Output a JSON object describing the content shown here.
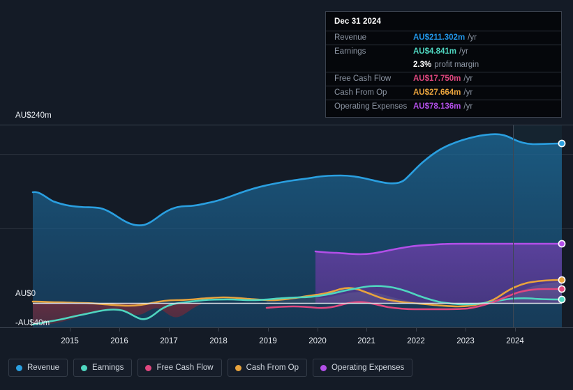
{
  "tooltip": {
    "date": "Dec 31 2024",
    "rows": [
      {
        "key": "Revenue",
        "value": "AU$211.302m",
        "unit": "/yr",
        "color": "#2196e8"
      },
      {
        "key": "Earnings",
        "value": "AU$4.841m",
        "unit": "/yr",
        "color": "#4fd6c0"
      },
      {
        "key": "",
        "value": "2.3%",
        "unit": "profit margin",
        "color": "#ffffff",
        "margin": true
      },
      {
        "key": "Free Cash Flow",
        "value": "AU$17.750m",
        "unit": "/yr",
        "color": "#e0477f"
      },
      {
        "key": "Cash From Op",
        "value": "AU$27.664m",
        "unit": "/yr",
        "color": "#e8a33d"
      },
      {
        "key": "Operating Expenses",
        "value": "AU$78.136m",
        "unit": "/yr",
        "color": "#b24fe8"
      }
    ]
  },
  "legend": [
    {
      "label": "Revenue",
      "color": "#2a9fe0"
    },
    {
      "label": "Earnings",
      "color": "#4fd6c0"
    },
    {
      "label": "Free Cash Flow",
      "color": "#e0477f"
    },
    {
      "label": "Cash From Op",
      "color": "#e8a33d"
    },
    {
      "label": "Operating Expenses",
      "color": "#b24fe8"
    }
  ],
  "axis": {
    "y_top_label": "AU$240m",
    "y_zero_label": "AU$0",
    "y_bottom_label": "-AU$40m",
    "x_labels": [
      "2015",
      "2016",
      "2017",
      "2018",
      "2019",
      "2020",
      "2021",
      "2022",
      "2023",
      "2024"
    ]
  },
  "chart_data": {
    "type": "area",
    "title": "",
    "xlabel": "",
    "ylabel": "AU$ millions",
    "ylim": [
      -40,
      240
    ],
    "grid": true,
    "legend_position": "bottom",
    "currency": "AU$",
    "units": "millions per year",
    "x": [
      2014.4,
      2014.8,
      2015.2,
      2015.6,
      2016.0,
      2016.4,
      2016.8,
      2017.2,
      2017.6,
      2018.0,
      2018.4,
      2018.8,
      2019.2,
      2019.6,
      2020.0,
      2020.4,
      2020.8,
      2021.2,
      2021.6,
      2022.0,
      2022.4,
      2022.8,
      2023.2,
      2023.6,
      2023.9,
      2024.3,
      2024.7,
      2024.95
    ],
    "series": [
      {
        "name": "Revenue",
        "color": "#2a9fe0",
        "filled": true,
        "values": [
          151,
          146,
          143,
          129,
          122,
          122,
          128,
          124,
          125,
          131,
          140,
          147,
          152,
          155,
          160,
          164,
          163,
          161,
          157,
          153,
          154,
          176,
          195,
          208,
          217,
          211,
          209,
          211.302
        ]
      },
      {
        "name": "Earnings",
        "color": "#4fd6c0",
        "filled": false,
        "values": [
          -36,
          -27,
          -24,
          -23,
          -19,
          -30,
          -13,
          -7,
          -4,
          -3,
          -2,
          -4,
          -6,
          -5,
          -3,
          0,
          3,
          6,
          9,
          10,
          7,
          3,
          1,
          2,
          3,
          4,
          5,
          4.841
        ]
      },
      {
        "name": "Free Cash Flow",
        "color": "#e0477f",
        "filled": false,
        "start_x": 2018.8,
        "values": [
          null,
          null,
          null,
          null,
          null,
          null,
          null,
          null,
          null,
          null,
          null,
          -7,
          -6,
          -5,
          -6,
          -4,
          -1,
          -4,
          -6,
          -6,
          -6,
          -6,
          -4,
          -1,
          7,
          15,
          17,
          17.75
        ]
      },
      {
        "name": "Cash From Op",
        "color": "#e8a33d",
        "filled": false,
        "values": [
          -3,
          -3,
          -3,
          -3,
          -3,
          -4,
          -4,
          -2,
          -1,
          0,
          0,
          -1,
          -2,
          -2,
          -1,
          1,
          4,
          1,
          -1,
          -2,
          -3,
          -5,
          -6,
          -3,
          6,
          22,
          27,
          27.664
        ]
      },
      {
        "name": "Operating Expenses",
        "color": "#b24fe8",
        "filled": true,
        "start_x": 2020.0,
        "values": [
          null,
          null,
          null,
          null,
          null,
          null,
          null,
          null,
          null,
          null,
          null,
          null,
          null,
          null,
          70,
          68,
          67,
          67,
          69,
          73,
          75,
          76,
          77,
          77,
          78,
          78,
          78,
          78.136
        ]
      }
    ],
    "highlight_point": {
      "date": "Dec 31 2024",
      "x": 2024.95
    },
    "forecast_divider_x": 2023.75
  }
}
